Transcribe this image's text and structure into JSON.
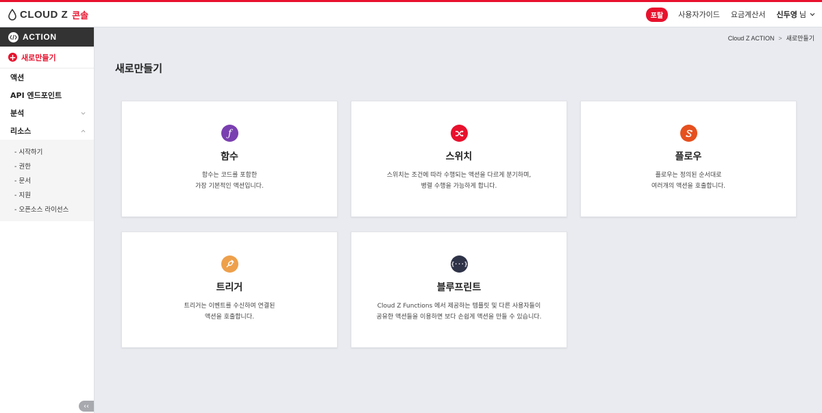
{
  "header": {
    "logo_text": "CLOUD Z",
    "logo_sub": "콘솔",
    "portal_label": "포탈",
    "guide_label": "사용자가이드",
    "pricing_label": "요금계산서",
    "user_name": "신두영",
    "user_suffix": "님"
  },
  "sidebar": {
    "title": "ACTION",
    "new_label": "새로만들기",
    "items": [
      {
        "label": "액션"
      },
      {
        "label": "API 엔드포인트"
      },
      {
        "label": "분석"
      },
      {
        "label": "리소스"
      }
    ],
    "sub_items": [
      {
        "label": "- 시작하기"
      },
      {
        "label": "- 권한"
      },
      {
        "label": "- 문서"
      },
      {
        "label": "- 지원"
      },
      {
        "label": "- 오픈소스 라이선스"
      }
    ],
    "collapse_label": "‹‹"
  },
  "breadcrumb": {
    "root": "Cloud Z ACTION",
    "separator": ">",
    "current": "새로만들기"
  },
  "page": {
    "title": "새로만들기"
  },
  "cards": [
    {
      "title": "함수",
      "desc1": "함수는 코드를 포함한",
      "desc2": "가장 기본적인 액션입니다.",
      "icon": "function-icon",
      "color": "#7a3fb0",
      "glyph": "ƒ"
    },
    {
      "title": "스위치",
      "desc1": "스위치는 조건에 따라 수행되는 액션을 다르게 분기하며,",
      "desc2": "병렬 수행을 가능하게 합니다.",
      "icon": "switch-icon",
      "color": "#e8112d",
      "glyph": "⇄"
    },
    {
      "title": "플로우",
      "desc1": "플로우는 정의된 순서대로",
      "desc2": "여러개의 액션을 호출합니다.",
      "icon": "flow-icon",
      "color": "#e6501e",
      "glyph": "S"
    },
    {
      "title": "트리거",
      "desc1": "트리거는 이벤트를 수신하여 연결된",
      "desc2": "액션을 호출합니다.",
      "icon": "trigger-icon",
      "color": "#eea04b",
      "glyph": "◎"
    },
    {
      "title": "블루프린트",
      "desc1": "Cloud Z Functions 에서 제공하는 템플릿 및 다른 사용자들이",
      "desc2": "공유한 액션들을 이용하면 보다 손쉽게 액션을 만들 수 있습니다.",
      "icon": "blueprint-icon",
      "color": "#2f3348",
      "glyph": "{···}"
    }
  ]
}
